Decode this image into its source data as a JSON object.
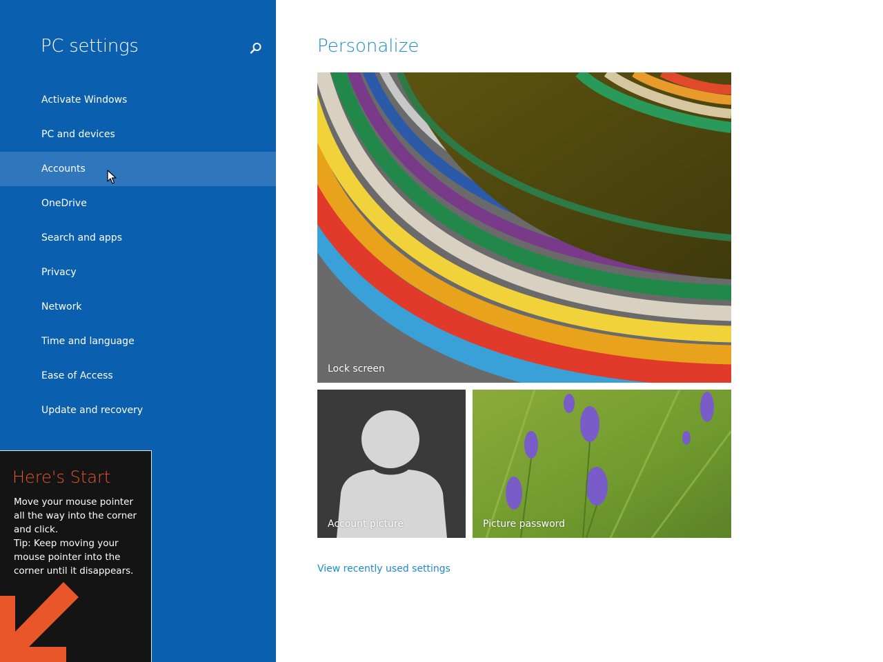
{
  "sidebar": {
    "title": "PC settings",
    "search_icon": "search-icon",
    "items": [
      {
        "label": "Activate Windows"
      },
      {
        "label": "PC and devices"
      },
      {
        "label": "Accounts"
      },
      {
        "label": "OneDrive"
      },
      {
        "label": "Search and apps"
      },
      {
        "label": "Privacy"
      },
      {
        "label": "Network"
      },
      {
        "label": "Time and language"
      },
      {
        "label": "Ease of Access"
      },
      {
        "label": "Update and recovery"
      }
    ],
    "selected_item": "Accounts"
  },
  "tip": {
    "title": "Here's Start",
    "body": "Move your mouse pointer\nall the way into the corner\nand click.\nTip: Keep moving your\nmouse pointer into the\ncorner until it disappears."
  },
  "main": {
    "title": "Personalize",
    "tiles": {
      "lock_screen": "Lock screen",
      "account_picture": "Account picture",
      "picture_password": "Picture password"
    },
    "recent_link": "View recently used settings"
  },
  "colors": {
    "sidebar_bg": "#0a5fae",
    "sidebar_selected": "#2f76bd",
    "accent": "#1b8ad0",
    "tip_title": "#e8562a"
  }
}
